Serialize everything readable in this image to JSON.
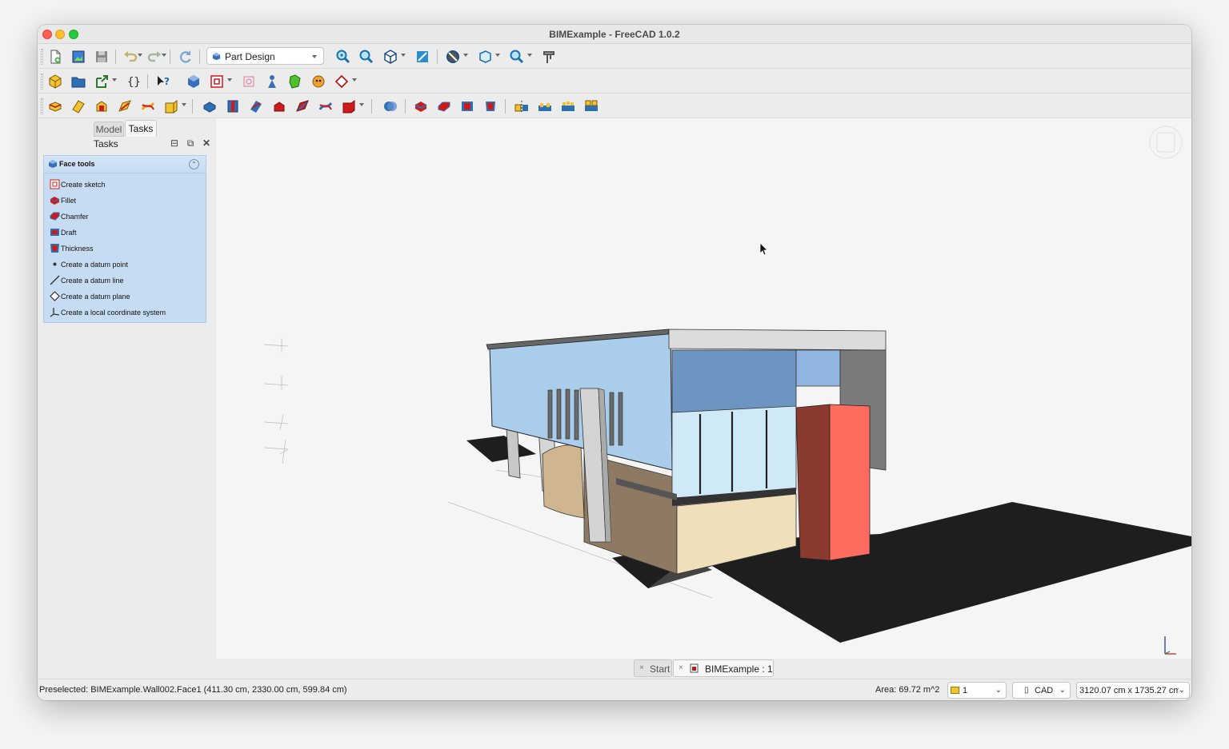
{
  "window": {
    "title": "BIMExample - FreeCAD 1.0.2"
  },
  "toolbar": {
    "workbench": "Part Design"
  },
  "left_panel": {
    "tabs": [
      {
        "label": "Model"
      },
      {
        "label": "Tasks"
      }
    ],
    "title": "Tasks",
    "taskbox": {
      "title": "Face tools",
      "items": [
        {
          "label": "Create sketch",
          "icon": "create-sketch-icon"
        },
        {
          "label": "Fillet",
          "icon": "fillet-icon"
        },
        {
          "label": "Chamfer",
          "icon": "chamfer-icon"
        },
        {
          "label": "Draft",
          "icon": "draft-icon"
        },
        {
          "label": "Thickness",
          "icon": "thickness-icon"
        },
        {
          "label": "Create a datum point",
          "icon": "datum-point-icon"
        },
        {
          "label": "Create a datum line",
          "icon": "datum-line-icon"
        },
        {
          "label": "Create a datum plane",
          "icon": "datum-plane-icon"
        },
        {
          "label": "Create a local coordinate system",
          "icon": "local-coordinate-system-icon"
        }
      ]
    }
  },
  "document_tabs": [
    {
      "label": "Start"
    },
    {
      "label": "BIMExample : 1"
    }
  ],
  "status": {
    "preselected": "Preselected: BIMExample.Wall002.Face1 (411.30 cm, 2330.00 cm, 599.84 cm)",
    "area": "Area: 69.72 m^2",
    "layer": "1",
    "navigation": "CAD",
    "dimensions": "3120.07 cm x 1735.27 cm"
  },
  "colors": {
    "wall_blue": "#a9cdea",
    "column_red": "#ff6b5e",
    "ground": "#1e1e1e",
    "taskbox": "#c6dcf2"
  }
}
